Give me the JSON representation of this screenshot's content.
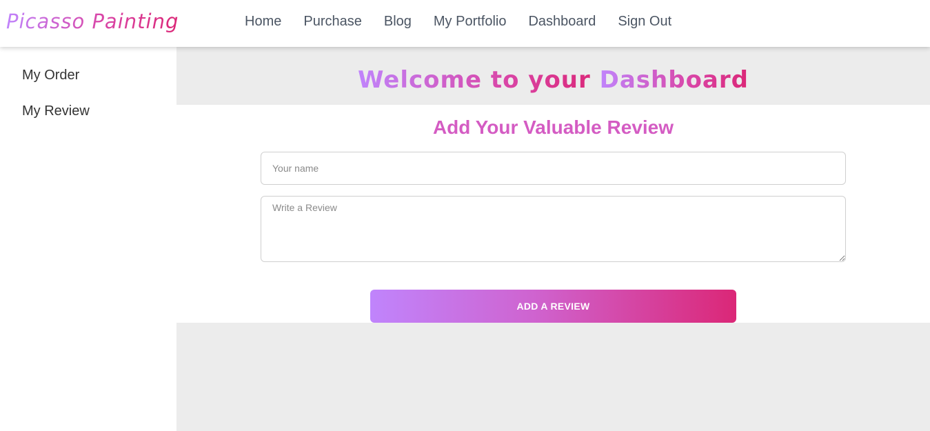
{
  "brand": {
    "name": "Picasso Painting"
  },
  "nav": {
    "items": [
      {
        "label": "Home"
      },
      {
        "label": "Purchase"
      },
      {
        "label": "Blog"
      },
      {
        "label": "My Portfolio"
      },
      {
        "label": "Dashboard"
      },
      {
        "label": "Sign Out"
      }
    ]
  },
  "sidebar": {
    "items": [
      {
        "label": "My Order"
      },
      {
        "label": "My Review"
      }
    ]
  },
  "dashboard": {
    "title_prefix": "Welcome to your ",
    "title_emphasis": "Dashboard"
  },
  "review_form": {
    "title": "Add Your Valuable Review",
    "name_placeholder": "Your name",
    "review_placeholder": "Write a Review",
    "submit_label": "ADD A REVIEW"
  },
  "colors": {
    "gradient_start": "#c084fc",
    "gradient_mid": "#d946a8",
    "gradient_end": "#db2777",
    "main_background": "#ececec"
  }
}
